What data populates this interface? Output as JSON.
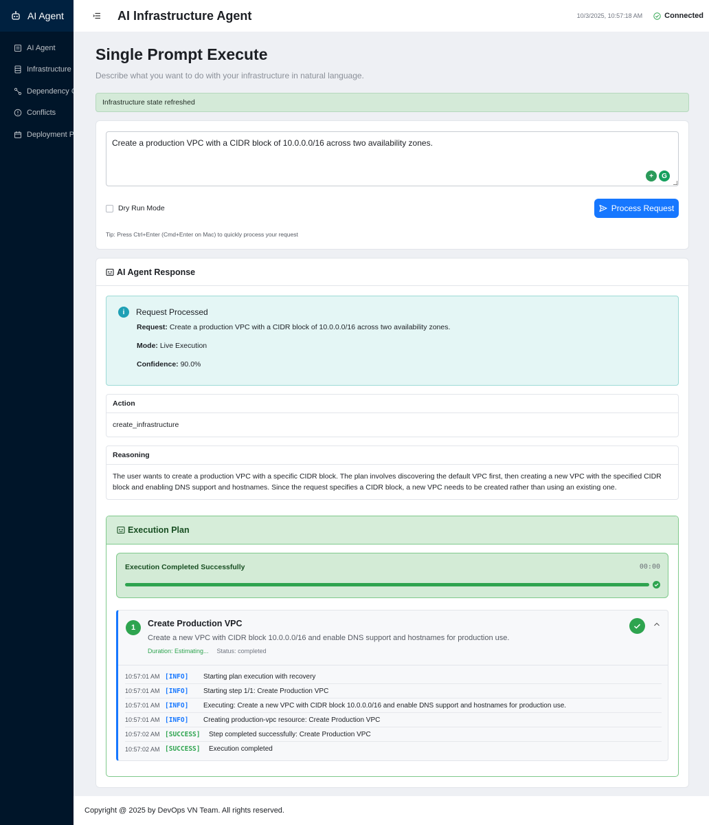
{
  "sidebar": {
    "brand": "AI Agent",
    "items": [
      {
        "label": "AI Agent",
        "icon": "robot-icon"
      },
      {
        "label": "Infrastructure S",
        "icon": "database-icon"
      },
      {
        "label": "Dependency Gr",
        "icon": "share-icon"
      },
      {
        "label": "Conflicts",
        "icon": "exclamation-circle-icon"
      },
      {
        "label": "Deployment Pla",
        "icon": "calendar-icon"
      }
    ]
  },
  "header": {
    "title": "AI Infrastructure Agent",
    "timestamp": "10/3/2025, 10:57:18 AM",
    "connection_status": "Connected"
  },
  "page": {
    "title": "Single Prompt Execute",
    "subtitle": "Describe what you want to do with your infrastructure in natural language."
  },
  "alert": {
    "text": "Infrastructure state refreshed"
  },
  "input": {
    "prompt_value": "Create a production VPC with a CIDR block of 10.0.0.0/16 across two availability zones.",
    "dry_run_label": "Dry Run Mode",
    "dry_run_checked": false,
    "process_button": "Process Request",
    "tip": "Tip: Press Ctrl+Enter (Cmd+Enter on Mac) to quickly process your request"
  },
  "response": {
    "title": "AI Agent Response",
    "status_title": "Request Processed",
    "request_label": "Request:",
    "request_value": "Create a production VPC with a CIDR block of 10.0.0.0/16 across two availability zones.",
    "mode_label": "Mode:",
    "mode_value": "Live Execution",
    "confidence_label": "Confidence:",
    "confidence_value": "90.0%",
    "action_label": "Action",
    "action_value": "create_infrastructure",
    "reasoning_label": "Reasoning",
    "reasoning_value": "The user wants to create a production VPC with a specific CIDR block. The plan involves discovering the default VPC first, then creating a new VPC with the specified CIDR block and enabling DNS support and hostnames. Since the request specifies a CIDR block, a new VPC needs to be created rather than using an existing one."
  },
  "execution": {
    "title": "Execution Plan",
    "status": "Execution Completed Successfully",
    "timer": "00:00",
    "progress": 1.0,
    "step": {
      "number": "1",
      "title": "Create Production VPC",
      "description": "Create a new VPC with CIDR block 10.0.0.0/16 and enable DNS support and hostnames for production use.",
      "duration": "Duration: Estimating...",
      "status": "Status: completed"
    },
    "logs": [
      {
        "time": "10:57:01 AM",
        "level": "[INFO]",
        "type": "info",
        "message": "Starting plan execution with recovery"
      },
      {
        "time": "10:57:01 AM",
        "level": "[INFO]",
        "type": "info",
        "message": "Starting step 1/1: Create Production VPC"
      },
      {
        "time": "10:57:01 AM",
        "level": "[INFO]",
        "type": "info",
        "message": "Executing: Create a new VPC with CIDR block 10.0.0.0/16 and enable DNS support and hostnames for production use."
      },
      {
        "time": "10:57:01 AM",
        "level": "[INFO]",
        "type": "info",
        "message": "Creating production-vpc resource: Create Production VPC"
      },
      {
        "time": "10:57:02 AM",
        "level": "[SUCCESS]",
        "type": "success",
        "message": "Step completed successfully: Create Production VPC"
      },
      {
        "time": "10:57:02 AM",
        "level": "[SUCCESS]",
        "type": "success",
        "message": "Execution completed"
      }
    ]
  },
  "footer": {
    "text": "Copyright @ 2025 by DevOps VN Team. All rights reserved."
  },
  "colors": {
    "sidebar": "#001529",
    "primary": "#1677ff",
    "success": "#2ea44f",
    "info": "#1fa0b5"
  }
}
